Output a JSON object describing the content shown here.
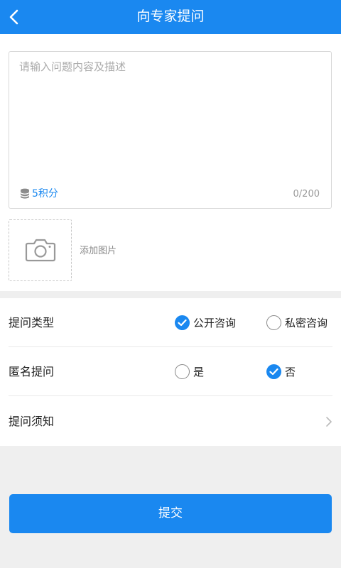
{
  "header": {
    "title": "向专家提问",
    "back_icon": "chevron-left-icon"
  },
  "question": {
    "placeholder": "请输入问题内容及描述",
    "value": "",
    "points_label": "5积分",
    "points_icon": "coin-stack-icon",
    "counter": "0/200"
  },
  "photo": {
    "add_label": "添加图片",
    "icon": "camera-icon"
  },
  "options": {
    "question_type": {
      "label": "提问类型",
      "choices": [
        {
          "label": "公开咨询",
          "selected": true
        },
        {
          "label": "私密咨询",
          "selected": false
        }
      ]
    },
    "anonymous": {
      "label": "匿名提问",
      "choices": [
        {
          "label": "是",
          "selected": false
        },
        {
          "label": "否",
          "selected": true
        }
      ]
    },
    "notice": {
      "label": "提问须知",
      "icon": "chevron-right-icon"
    }
  },
  "submit": {
    "label": "提交"
  },
  "colors": {
    "accent": "#1a88f0",
    "background": "#efefef",
    "placeholder": "#aaaaaa"
  }
}
